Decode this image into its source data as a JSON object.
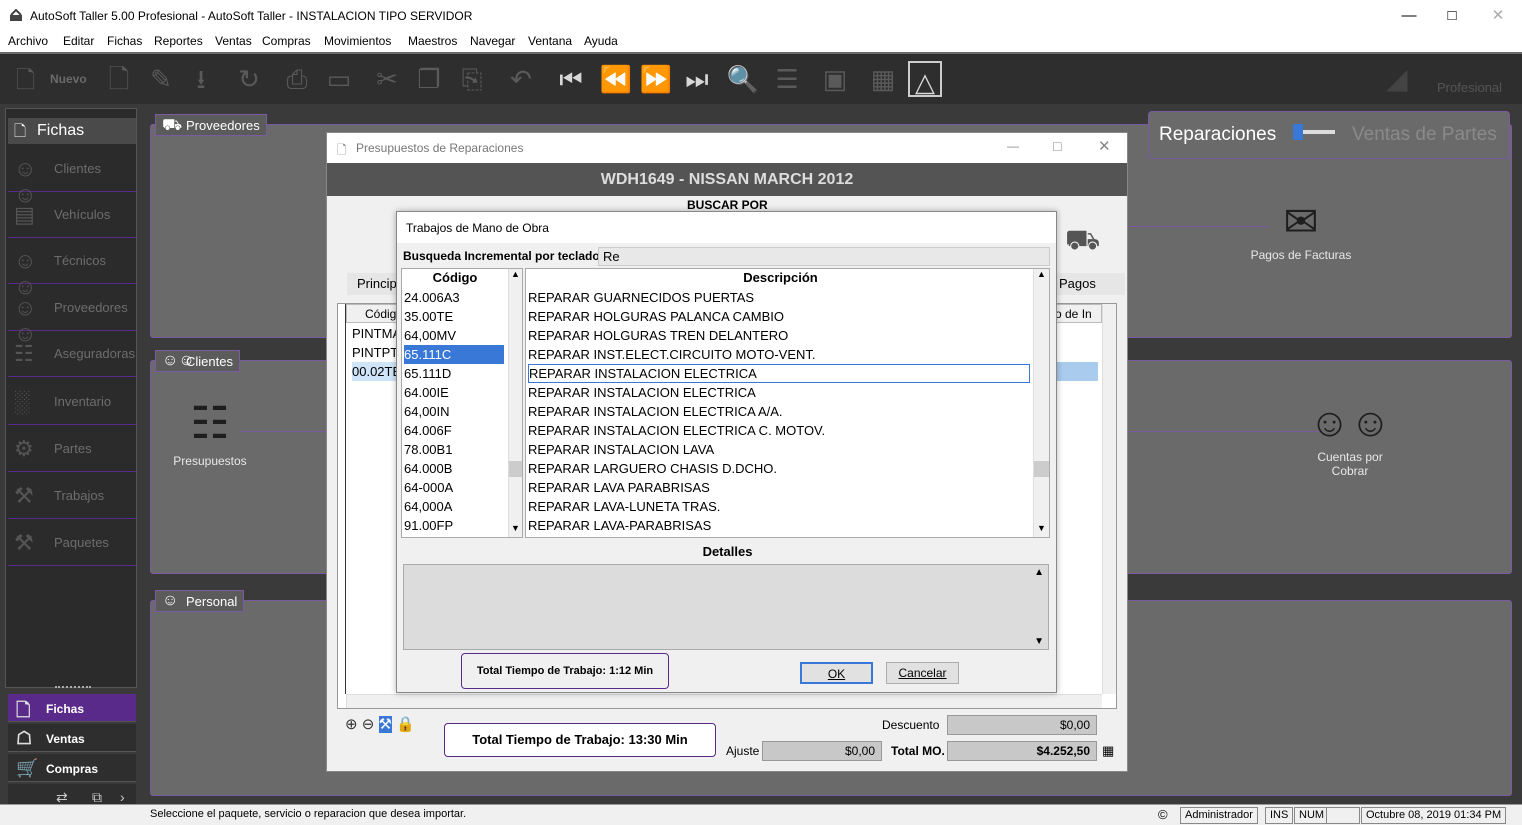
{
  "window": {
    "title": "AutoSoft Taller 5.00 Profesional - AutoSoft Taller - INSTALACION TIPO SERVIDOR"
  },
  "menu": [
    "Archivo",
    "Editar",
    "Fichas",
    "Reportes",
    "Ventas",
    "Compras",
    "Movimientos",
    "Maestros",
    "Navegar",
    "Ventana",
    "Ayuda"
  ],
  "toolbar": {
    "nuevo": "Nuevo",
    "brand": "Profesional"
  },
  "sidebar": {
    "header": "Fichas",
    "items": [
      "Clientes",
      "Vehículos",
      "Técnicos",
      "Proveedores",
      "Aseguradoras",
      "Inventario",
      "Partes",
      "Trabajos",
      "Paquetes"
    ],
    "bottom": [
      "Fichas",
      "Ventas",
      "Compras"
    ]
  },
  "panels": {
    "proveedores": "Proveedores",
    "clientes": "Clientes",
    "personal": "Personal",
    "mode_left": "Reparaciones",
    "mode_right": "Ventas de Partes",
    "pagos": "Pagos de Facturas",
    "presupuestos": "Presupuestos",
    "cuentas_line1": "Cuentas por",
    "cuentas_line2": "Cobrar"
  },
  "presupuesto": {
    "title": "Presupuestos de Reparaciones",
    "vehicle": "WDH1649 - NISSAN MARCH 2012",
    "buscar": "BUSCAR POR",
    "tab_principal": "Principa",
    "tab_pagos": "Pagos",
    "col_codigo": "Códig",
    "col_right": "o de In",
    "rows": [
      "PINTMA",
      "PINTPT",
      "00.02TE"
    ],
    "total_tiempo": "Total Tiempo de Trabajo: 13:30 Min",
    "descuento_label": "Descuento",
    "descuento_value": "$0,00",
    "ajuste_label": "Ajuste",
    "ajuste_value": "$0,00",
    "totalmo_label": "Total MO.",
    "totalmo_value": "$4.252,50"
  },
  "trabajos": {
    "title": "Trabajos de Mano de Obra",
    "search_label": "Busqueda Incremental por teclado:",
    "search_value": "Re",
    "col_codigo": "Código",
    "col_desc": "Descripción",
    "codes": [
      "24.006A3",
      "35.00TE",
      "64,00MV",
      "65.111C",
      "65.111D",
      "64.00IE",
      "64,00IN",
      "64.006F",
      "78.00B1",
      "64.000B",
      "64-000A",
      "64,000A",
      "91.00FP"
    ],
    "descriptions": [
      "REPARAR GUARNECIDOS PUERTAS",
      "REPARAR HOLGURAS PALANCA CAMBIO",
      "REPARAR HOLGURAS TREN DELANTERO",
      "REPARAR INST.ELECT.CIRCUITO MOTO-VENT.",
      "REPARAR INSTALACION ELECTRICA",
      "REPARAR INSTALACION ELECTRICA",
      "REPARAR INSTALACION ELECTRICA A/A.",
      "REPARAR INSTALACION ELECTRICA C. MOTOV.",
      "REPARAR INSTALACION LAVA",
      "REPARAR LARGUERO CHASIS D.DCHO.",
      "REPARAR LAVA PARABRISAS",
      "REPARAR LAVA-LUNETA TRAS.",
      "REPARAR LAVA-PARABRISAS"
    ],
    "detalles": "Detalles",
    "total_tiempo": "Total Tiempo de Trabajo: 1:12 Min",
    "ok": "OK",
    "cancel": "Cancelar"
  },
  "status": {
    "message": "Seleccione el paquete, servicio o reparacion que desea importar.",
    "user": "Administrador",
    "ins": "INS",
    "num": "NUM",
    "date": "Octubre 08, 2019 01:34 PM"
  },
  "colors": {
    "accent": "#7a5aa0",
    "selection": "#3a78d8",
    "dark_bg": "#3a3a3a",
    "panel_bg": "#6a6a6a"
  }
}
